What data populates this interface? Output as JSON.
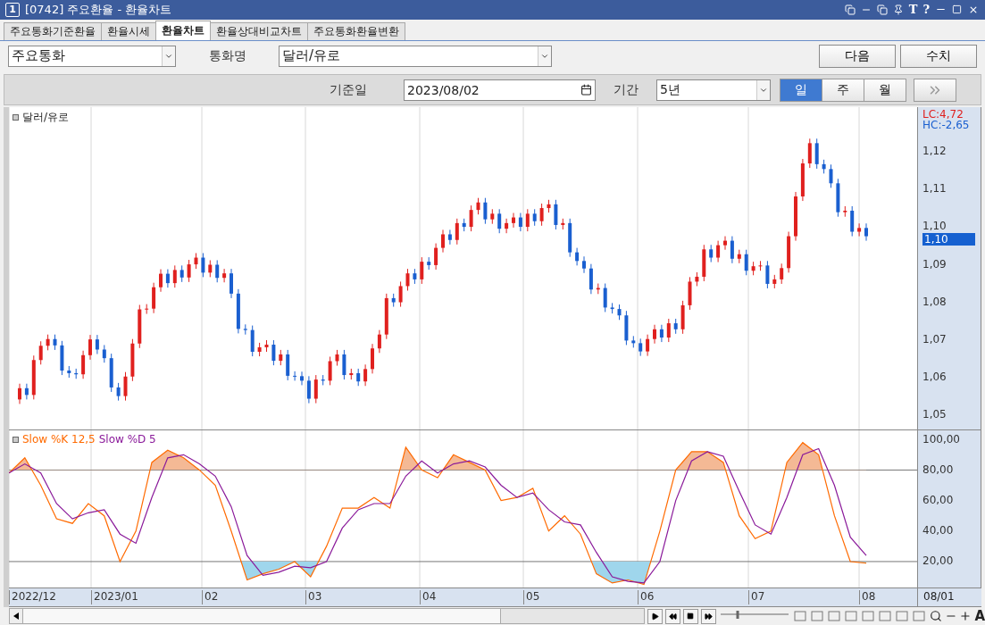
{
  "window": {
    "number": "1",
    "title": "[0742] 주요환율 - 환율차트",
    "tools": [
      "T",
      "?"
    ]
  },
  "tabs": [
    {
      "label": "주요통화기준환율",
      "selected": false
    },
    {
      "label": "환율시세",
      "selected": false
    },
    {
      "label": "환율차트",
      "selected": true
    },
    {
      "label": "환율상대비교차트",
      "selected": false
    },
    {
      "label": "주요통화환율변환",
      "selected": false
    }
  ],
  "market_select": {
    "value": "주요통화"
  },
  "currency": {
    "label": "통화명",
    "value": "달러/유로"
  },
  "buttons": [
    "다음",
    "수치"
  ],
  "base_date": {
    "label": "기준일",
    "value": "2023/08/02"
  },
  "period": {
    "label": "기간",
    "value": "5년"
  },
  "intervals": [
    {
      "label": "일",
      "selected": true
    },
    {
      "label": "주",
      "selected": false
    },
    {
      "label": "월",
      "selected": false
    }
  ],
  "price_chart": {
    "legend": "달러/유로",
    "lc": "LC:4,72",
    "hc": "HC:-2,65",
    "current": "1,10",
    "chart_data": {
      "type": "candlestick",
      "grid": true,
      "ylim": [
        1.046,
        1.1319
      ],
      "yticks": [
        {
          "value": 1.12,
          "label": "1,12"
        },
        {
          "value": 1.11,
          "label": "1,11"
        },
        {
          "value": 1.1,
          "label": "1,10"
        },
        {
          "value": 1.09,
          "label": "1,09"
        },
        {
          "value": 1.08,
          "label": "1,08"
        },
        {
          "value": 1.07,
          "label": "1,07"
        },
        {
          "value": 1.06,
          "label": "1,06"
        },
        {
          "value": 1.05,
          "label": "1,05"
        }
      ],
      "categories": [
        null,
        null,
        null,
        null,
        null,
        null,
        null,
        null,
        null,
        null,
        null,
        null,
        null,
        null,
        null,
        null,
        null,
        null,
        null,
        null,
        null,
        null,
        null,
        null,
        null,
        null,
        null,
        null,
        null,
        null,
        null,
        null,
        null,
        null,
        null,
        null,
        null,
        null,
        null,
        null,
        null,
        null,
        null,
        null,
        null,
        null,
        null,
        null,
        null,
        null,
        null,
        null,
        null,
        null,
        null,
        null,
        null,
        null,
        null,
        null,
        null,
        null,
        null,
        null,
        null,
        null,
        null,
        null,
        null,
        null,
        null,
        null,
        null,
        null,
        null,
        null,
        null,
        null,
        null,
        null,
        null,
        null,
        null,
        null,
        null,
        null,
        null,
        null,
        null,
        null,
        null,
        null,
        null,
        null,
        null,
        null,
        null,
        null,
        null,
        null,
        null,
        null,
        null,
        null,
        null,
        null,
        null,
        null,
        null,
        null,
        null,
        null,
        null,
        null,
        null,
        null,
        null,
        null,
        null,
        null,
        null
      ],
      "ohlc": [
        [
          1.054,
          1.0582,
          1.0528,
          1.057
        ],
        [
          1.057,
          1.0582,
          1.054,
          1.0552
        ],
        [
          1.0552,
          1.0657,
          1.054,
          1.0645
        ],
        [
          1.0645,
          1.0695,
          1.0633,
          1.0683
        ],
        [
          1.0683,
          1.0713,
          1.0671,
          1.0701
        ],
        [
          1.0701,
          1.0713,
          1.0672,
          1.0684
        ],
        [
          1.0684,
          1.0696,
          1.0605,
          1.0617
        ],
        [
          1.0617,
          1.0629,
          1.0598,
          1.061
        ],
        [
          1.061,
          1.0622,
          1.0595,
          1.0607
        ],
        [
          1.0607,
          1.067,
          1.0595,
          1.0658
        ],
        [
          1.0658,
          1.0712,
          1.0646,
          1.07
        ],
        [
          1.07,
          1.0712,
          1.0661,
          1.0673
        ],
        [
          1.0673,
          1.0685,
          1.0638,
          1.065
        ],
        [
          1.065,
          1.0662,
          1.056,
          1.0572
        ],
        [
          1.0572,
          1.0584,
          1.0537,
          1.0549
        ],
        [
          1.0549,
          1.0613,
          1.0537,
          1.0601
        ],
        [
          1.0601,
          1.0701,
          1.0589,
          1.0689
        ],
        [
          1.0689,
          1.0792,
          1.0677,
          1.078
        ],
        [
          1.078,
          1.0794,
          1.0768,
          1.0782
        ],
        [
          1.0782,
          1.0851,
          1.077,
          1.0839
        ],
        [
          1.0839,
          1.0887,
          1.0827,
          1.0875
        ],
        [
          1.0875,
          1.0887,
          1.0838,
          1.085
        ],
        [
          1.085,
          1.0897,
          1.0838,
          1.0885
        ],
        [
          1.0885,
          1.0897,
          1.0853,
          1.0865
        ],
        [
          1.0865,
          1.0912,
          1.0853,
          1.09
        ],
        [
          1.09,
          1.093,
          1.0888,
          1.0918
        ],
        [
          1.0918,
          1.093,
          1.0866,
          1.0878
        ],
        [
          1.0878,
          1.0911,
          1.0866,
          1.0899
        ],
        [
          1.0899,
          1.0911,
          1.0852,
          1.0864
        ],
        [
          1.0864,
          1.0888,
          1.0852,
          1.0876
        ],
        [
          1.0876,
          1.0888,
          1.081,
          1.0822
        ],
        [
          1.0822,
          1.0834,
          1.0716,
          1.0728
        ],
        [
          1.0728,
          1.074,
          1.0713,
          1.0725
        ],
        [
          1.0725,
          1.0737,
          1.0655,
          1.0667
        ],
        [
          1.0667,
          1.0691,
          1.0655,
          1.0679
        ],
        [
          1.0679,
          1.0698,
          1.0667,
          1.0686
        ],
        [
          1.0686,
          1.0698,
          1.0631,
          1.0643
        ],
        [
          1.0643,
          1.0672,
          1.0631,
          1.066
        ],
        [
          1.066,
          1.0672,
          1.0591,
          1.0603
        ],
        [
          1.0603,
          1.0615,
          1.059,
          1.0602
        ],
        [
          1.0602,
          1.0614,
          1.0578,
          1.059
        ],
        [
          1.059,
          1.0602,
          1.053,
          1.0542
        ],
        [
          1.0542,
          1.0605,
          1.053,
          1.0593
        ],
        [
          1.0593,
          1.0605,
          1.0578,
          1.059
        ],
        [
          1.059,
          1.0654,
          1.0578,
          1.0642
        ],
        [
          1.0642,
          1.0672,
          1.063,
          1.066
        ],
        [
          1.066,
          1.0672,
          1.0593,
          1.0605
        ],
        [
          1.0605,
          1.0622,
          1.0593,
          1.061
        ],
        [
          1.061,
          1.0622,
          1.0576,
          1.0588
        ],
        [
          1.0588,
          1.0633,
          1.0576,
          1.0621
        ],
        [
          1.0621,
          1.0688,
          1.0609,
          1.0676
        ],
        [
          1.0676,
          1.0725,
          1.0664,
          1.0713
        ],
        [
          1.0713,
          1.0822,
          1.0701,
          1.081
        ],
        [
          1.081,
          1.0822,
          1.0787,
          1.0799
        ],
        [
          1.0799,
          1.0854,
          1.0787,
          1.0842
        ],
        [
          1.0842,
          1.0888,
          1.083,
          1.0876
        ],
        [
          1.0876,
          1.0888,
          1.0848,
          1.086
        ],
        [
          1.086,
          1.0919,
          1.0848,
          1.0907
        ],
        [
          1.0907,
          1.0919,
          1.0886,
          1.0898
        ],
        [
          1.0898,
          1.0956,
          1.0886,
          1.0944
        ],
        [
          1.0944,
          1.0992,
          1.0932,
          1.098
        ],
        [
          1.098,
          1.0992,
          1.0953,
          1.0965
        ],
        [
          1.0965,
          1.1022,
          1.0953,
          1.101
        ],
        [
          1.101,
          1.1022,
          1.0988,
          1.1
        ],
        [
          1.1,
          1.1057,
          1.0988,
          1.1045
        ],
        [
          1.1045,
          1.1077,
          1.1033,
          1.1065
        ],
        [
          1.1065,
          1.1077,
          1.1008,
          1.102
        ],
        [
          1.102,
          1.1047,
          1.1008,
          1.1035
        ],
        [
          1.1035,
          1.1047,
          1.0983,
          1.0995
        ],
        [
          1.0995,
          1.1022,
          1.0983,
          1.101
        ],
        [
          1.101,
          1.1037,
          1.0998,
          1.1025
        ],
        [
          1.1025,
          1.1037,
          1.0988,
          1.1
        ],
        [
          1.1,
          1.1047,
          1.0988,
          1.1035
        ],
        [
          1.1035,
          1.1047,
          1.1003,
          1.1015
        ],
        [
          1.1015,
          1.1062,
          1.1003,
          1.105
        ],
        [
          1.105,
          1.1072,
          1.1038,
          1.106
        ],
        [
          1.106,
          1.1072,
          1.0993,
          1.1005
        ],
        [
          1.1005,
          1.1022,
          1.0993,
          1.101
        ],
        [
          1.101,
          1.1022,
          1.092,
          1.0932
        ],
        [
          1.0932,
          1.0944,
          1.0897,
          1.0909
        ],
        [
          1.0909,
          1.0921,
          1.0877,
          1.0889
        ],
        [
          1.0889,
          1.0901,
          1.0821,
          1.0833
        ],
        [
          1.0833,
          1.0849,
          1.0821,
          1.0837
        ],
        [
          1.0837,
          1.0849,
          1.0773,
          1.0785
        ],
        [
          1.0785,
          1.0797,
          1.0769,
          1.0781
        ],
        [
          1.0781,
          1.0793,
          1.0752,
          1.0764
        ],
        [
          1.0764,
          1.0776,
          1.0685,
          1.0697
        ],
        [
          1.0697,
          1.0709,
          1.0678,
          1.069
        ],
        [
          1.069,
          1.0702,
          1.0656,
          1.0668
        ],
        [
          1.0668,
          1.0713,
          1.0656,
          1.0701
        ],
        [
          1.0701,
          1.0739,
          1.0689,
          1.0727
        ],
        [
          1.0727,
          1.0739,
          1.0693,
          1.0705
        ],
        [
          1.0705,
          1.0755,
          1.0693,
          1.0743
        ],
        [
          1.0743,
          1.0755,
          1.0715,
          1.0727
        ],
        [
          1.0727,
          1.0803,
          1.0715,
          1.0791
        ],
        [
          1.0791,
          1.0866,
          1.0779,
          1.0854
        ],
        [
          1.0854,
          1.0879,
          1.0842,
          1.0867
        ],
        [
          1.0867,
          1.0952,
          1.0855,
          1.094
        ],
        [
          1.094,
          1.0952,
          1.0906,
          1.0918
        ],
        [
          1.0918,
          1.0963,
          1.0906,
          1.0951
        ],
        [
          1.0951,
          1.0975,
          1.0939,
          1.0963
        ],
        [
          1.0963,
          1.0975,
          1.0903,
          1.0915
        ],
        [
          1.0915,
          1.0939,
          1.0903,
          1.0927
        ],
        [
          1.0927,
          1.0939,
          1.0871,
          1.0883
        ],
        [
          1.0883,
          1.0907,
          1.0871,
          1.0895
        ],
        [
          1.0895,
          1.0909,
          1.0883,
          1.0897
        ],
        [
          1.0897,
          1.0909,
          1.0836,
          1.0848
        ],
        [
          1.0848,
          1.0872,
          1.0836,
          1.086
        ],
        [
          1.086,
          1.0902,
          1.0848,
          1.089
        ],
        [
          1.089,
          1.0987,
          1.0878,
          1.0975
        ],
        [
          1.0975,
          1.1093,
          1.0963,
          1.1081
        ],
        [
          1.1081,
          1.1181,
          1.1069,
          1.1169
        ],
        [
          1.1169,
          1.1235,
          1.1157,
          1.1223
        ],
        [
          1.1223,
          1.1235,
          1.1155,
          1.1167
        ],
        [
          1.1167,
          1.1179,
          1.1142,
          1.1154
        ],
        [
          1.1154,
          1.1166,
          1.1104,
          1.1116
        ],
        [
          1.1116,
          1.1128,
          1.1027,
          1.1039
        ],
        [
          1.1039,
          1.1055,
          1.1027,
          1.1043
        ],
        [
          1.1043,
          1.1055,
          1.0975,
          1.0987
        ],
        [
          1.0987,
          1.1009,
          1.0975,
          1.0997
        ],
        [
          1.0997,
          1.1009,
          1.0963,
          1.0975
        ]
      ]
    }
  },
  "oscillator": {
    "chart_data": {
      "type": "line",
      "grid": true,
      "categories": [
        null,
        null,
        null,
        null,
        null,
        null,
        null,
        null,
        null,
        null,
        null,
        null,
        null,
        null,
        null,
        null,
        null,
        null,
        null,
        null,
        null,
        null,
        null,
        null,
        null,
        null,
        null,
        null,
        null,
        null,
        null,
        null,
        null,
        null,
        null,
        null,
        null,
        null,
        null,
        null,
        null,
        null,
        null,
        null,
        null,
        null,
        null,
        null,
        null,
        null,
        null,
        null,
        null,
        null,
        null
      ],
      "series": [
        {
          "name": "Slow %K 12,5",
          "color": "#ff6a00",
          "values": [
            78,
            88,
            70,
            48,
            45,
            58,
            50,
            20,
            40,
            85,
            93,
            88,
            80,
            70,
            40,
            8,
            12,
            15,
            20,
            10,
            30,
            55,
            55,
            62,
            55,
            95,
            80,
            75,
            90,
            85,
            80,
            60,
            62,
            68,
            40,
            50,
            38,
            12,
            6,
            8,
            5,
            40,
            80,
            92,
            92,
            85,
            50,
            35,
            40,
            85,
            98,
            90,
            50,
            20,
            19
          ]
        },
        {
          "name": "Slow %D 5",
          "color": "#8a1a9a",
          "values": [
            78,
            84,
            78,
            58,
            48,
            52,
            54,
            38,
            32,
            62,
            88,
            90,
            84,
            76,
            56,
            24,
            11,
            13,
            17,
            16,
            20,
            42,
            54,
            58,
            58,
            76,
            86,
            78,
            84,
            86,
            82,
            70,
            62,
            65,
            54,
            46,
            44,
            26,
            10,
            7,
            6,
            20,
            60,
            86,
            92,
            89,
            66,
            44,
            38,
            62,
            90,
            94,
            70,
            36,
            24
          ]
        }
      ],
      "ylim": [
        3,
        106
      ],
      "yticks": [
        {
          "value": 100,
          "label": "100,00"
        },
        {
          "value": 80,
          "label": "80,00"
        },
        {
          "value": 60,
          "label": "60,00"
        },
        {
          "value": 40,
          "label": "40,00"
        },
        {
          "value": 20,
          "label": "20,00"
        }
      ]
    }
  },
  "x_labels": [
    "2022/12",
    "2023/01",
    "02",
    "03",
    "04",
    "05",
    "06",
    "07",
    "08"
  ],
  "zoom": {
    "level": 0.25
  },
  "x_last": "08/01",
  "font_button": "A"
}
